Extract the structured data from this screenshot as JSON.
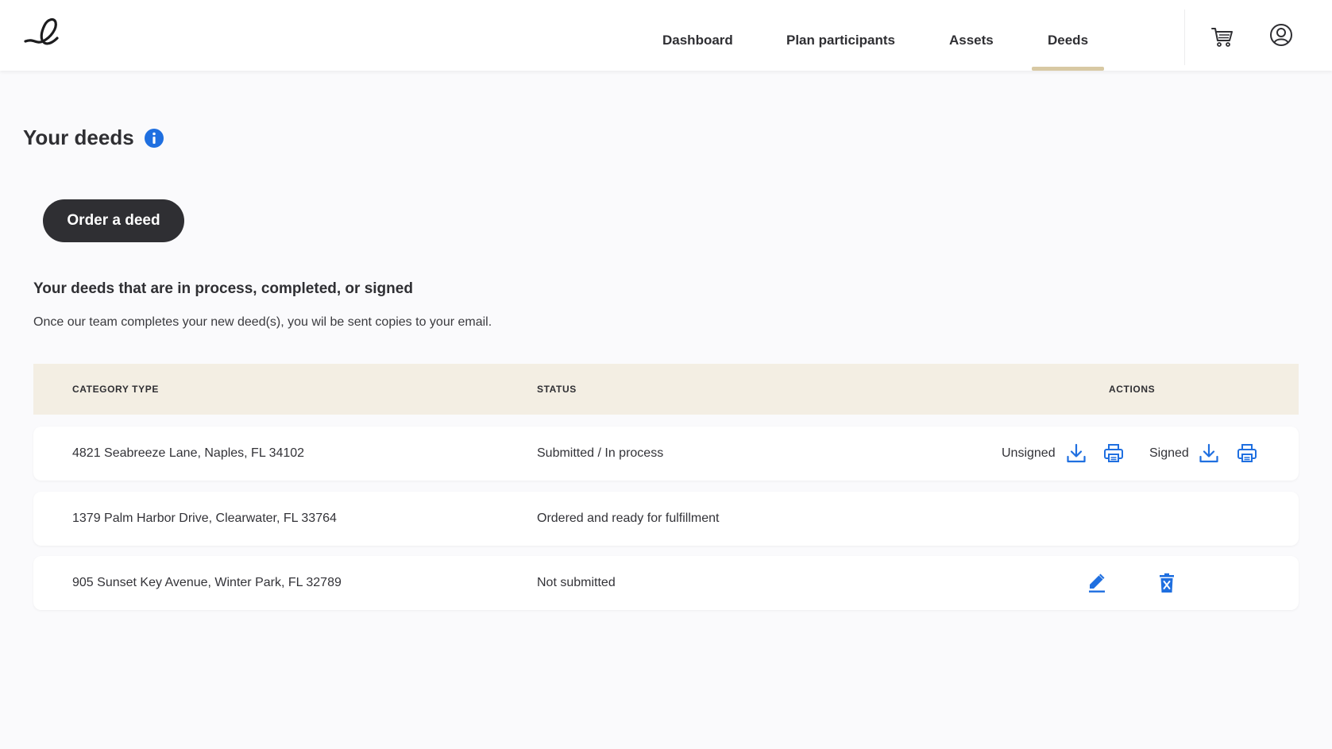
{
  "header": {
    "logo_glyph": "e",
    "nav": [
      {
        "label": "Dashboard"
      },
      {
        "label": "Plan participants"
      },
      {
        "label": "Assets"
      },
      {
        "label": "Deeds",
        "active": true
      }
    ],
    "icons": [
      "cart-icon",
      "account-icon"
    ]
  },
  "page": {
    "title": "Your deeds",
    "title_icon": "info-icon",
    "order_button": "Order a deed",
    "section_title": "Your deeds that are in process, completed, or signed",
    "section_subtitle": "Once our team completes your new deed(s), you wil be sent copies to your email."
  },
  "table": {
    "columns": [
      "CATEGORY TYPE",
      "STATUS",
      "ACTIONS"
    ],
    "rows": [
      {
        "category": "4821 Seabreeze Lane, Naples, FL 34102",
        "status": "Submitted / In process",
        "actions": {
          "unsigned_label": "Unsigned",
          "signed_label": "Signed",
          "icons": [
            "download-icon",
            "print-icon",
            "download-icon",
            "print-icon"
          ]
        }
      },
      {
        "category": "1379 Palm Harbor Drive, Clearwater, FL 33764",
        "status": "Ordered and ready for fulfillment",
        "actions": {}
      },
      {
        "category": "905 Sunset Key Avenue, Winter Park, FL 32789",
        "status": "Not submitted",
        "actions": {
          "icons": [
            "edit-icon",
            "delete-icon"
          ]
        }
      }
    ]
  },
  "colors": {
    "accent_blue": "#1f6fe0",
    "nav_underline": "#d8c9a3",
    "table_header_bg": "#f3eee3",
    "button_bg": "#2f2f33"
  }
}
